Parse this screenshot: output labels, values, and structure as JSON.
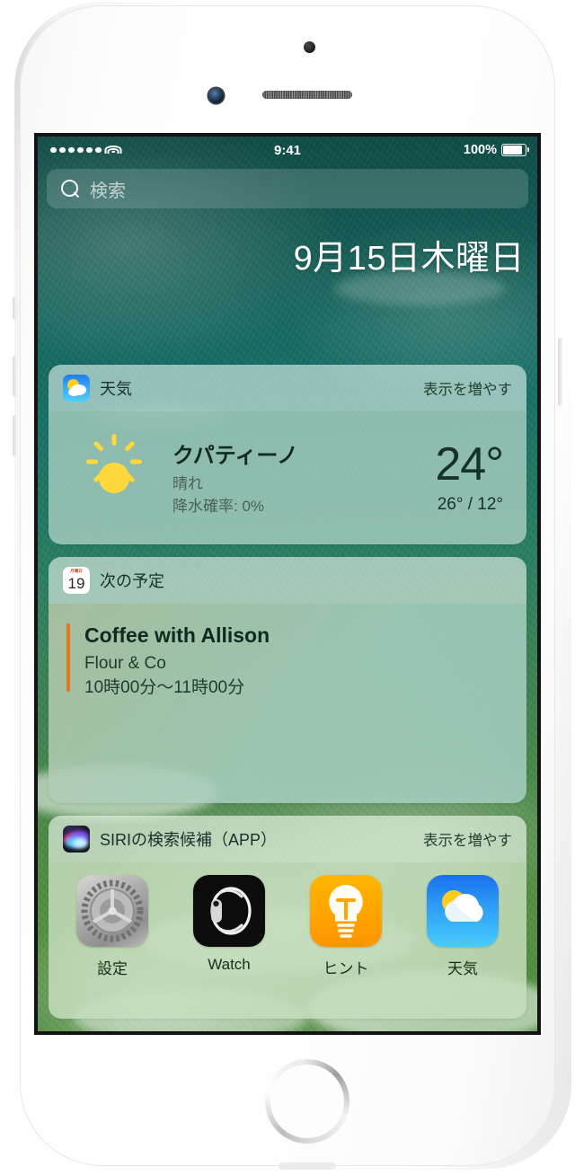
{
  "device": {
    "name": "iPhone",
    "home_button": "home-button"
  },
  "status_bar": {
    "signal_dots": 6,
    "wifi_icon": "wifi-icon",
    "time": "9:41",
    "battery_percent": "100%",
    "battery_icon": "battery-full-icon"
  },
  "search": {
    "icon": "search-icon",
    "placeholder": "検索",
    "value": ""
  },
  "date": {
    "text": "9月15日木曜日"
  },
  "widgets": [
    {
      "id": "weather",
      "icon": "weather-app-icon",
      "title": "天気",
      "more_label": "表示を増やす",
      "condition_icon": "sun-icon",
      "city": "クパティーノ",
      "condition": "晴れ",
      "precipitation": "降水確率: 0%",
      "temperature": "24°",
      "high_low": "26° / 12°"
    },
    {
      "id": "calendar",
      "icon": "calendar-app-icon",
      "icon_weekday": "月曜日",
      "icon_day": "19",
      "title": "次の予定",
      "more_label": "",
      "event": {
        "title": "Coffee with Allison",
        "location": "Flour & Co",
        "time": "10時00分〜11時00分",
        "accent_color": "#e8751a"
      }
    },
    {
      "id": "siri_app_suggestions",
      "icon": "siri-icon",
      "title": "SIRIの検索候補（APP）",
      "more_label": "表示を増やす",
      "apps": [
        {
          "icon": "settings-app-icon",
          "label": "設定"
        },
        {
          "icon": "watch-app-icon",
          "label": "Watch"
        },
        {
          "icon": "tips-app-icon",
          "label": "ヒント"
        },
        {
          "icon": "weather-app-icon",
          "label": "天気"
        }
      ]
    }
  ],
  "colors": {
    "wallpaper_top": "#135a54",
    "wallpaper_bottom": "#4b8a3e",
    "card_tint": "#aacec2",
    "event_accent": "#e8751a",
    "tips_orange": "#ffa400",
    "weather_blue": "#2d9bf4"
  }
}
